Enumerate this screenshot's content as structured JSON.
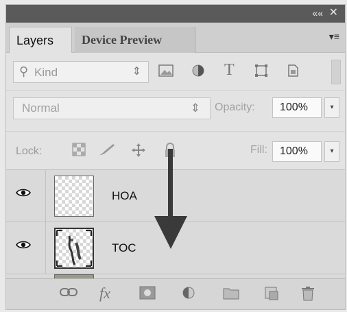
{
  "colors": {
    "titlebar": "#5a5a5a",
    "panel": "#e3e3e3",
    "arrow": "#3a3a3a"
  },
  "titlebar": {
    "collapse": "««",
    "close": "✕"
  },
  "tabs": [
    {
      "label": "Layers",
      "active": true
    },
    {
      "label": "Device Preview",
      "active": false
    }
  ],
  "panel_menu": "▾≡",
  "filter": {
    "label": "Kind",
    "search_icon": "⚲",
    "updown": "⇕",
    "icons": [
      "image-filter-icon",
      "adjustment-filter-icon",
      "type-filter-icon",
      "shape-filter-icon",
      "smart-object-filter-icon"
    ]
  },
  "blend": {
    "mode": "Normal",
    "updown": "⇕",
    "opacity_label": "Opacity:",
    "opacity_value": "100%"
  },
  "lock": {
    "label": "Lock:",
    "fill_label": "Fill:",
    "fill_value": "100%"
  },
  "dropdown_glyph": "▾",
  "layers": [
    {
      "name": "HOA",
      "visible": true
    },
    {
      "name": "TOC",
      "visible": true
    }
  ],
  "footer_icons": [
    "link-layers-icon",
    "fx-icon",
    "add-mask-icon",
    "adjustment-layer-icon",
    "new-group-icon",
    "new-layer-icon",
    "delete-layer-icon"
  ],
  "footer_glyphs": {
    "link": "⛓",
    "fx": "fx",
    "mask": "◙",
    "adjust": "◐",
    "group": "▭",
    "new": "⧉",
    "delete": "🗑"
  }
}
